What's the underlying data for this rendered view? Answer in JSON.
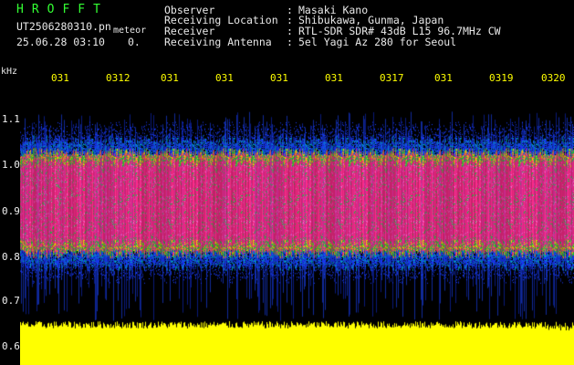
{
  "header": {
    "program": "HROFFT",
    "filename": "UT2506280310.pn",
    "tag": "meteor",
    "datetime": "25.06.28 03:10",
    "count": "0.",
    "fields": [
      {
        "label": "Observer",
        "value": "Masaki Kano"
      },
      {
        "label": "Receiving Location",
        "value": "Shibukawa, Gunma, Japan"
      },
      {
        "label": "Receiver",
        "value": "RTL-SDR SDR# 43dB L15 96.7MHz CW"
      },
      {
        "label": "Receiving Antenna",
        "value": "5el Yagi Az 280 for Seoul"
      }
    ],
    "sep": ":"
  },
  "axis": {
    "unit": "kHz",
    "ticks": [
      "1.1",
      "1.0",
      "0.9",
      "0.8",
      "0.7",
      "0.6"
    ]
  },
  "time_labels": [
    "031",
    "0312",
    "031",
    "031",
    "031",
    "031",
    "0317",
    "031",
    "0319",
    "0320"
  ],
  "colors": {
    "title": "#33ff33",
    "background": "#000000",
    "signal_core": "#ff2d8c",
    "signal_edge_green": "#22cc44",
    "signal_edge_blue": "#1a3cff",
    "power_trace": "#ffff00",
    "time_labels": "#ffff00"
  }
}
